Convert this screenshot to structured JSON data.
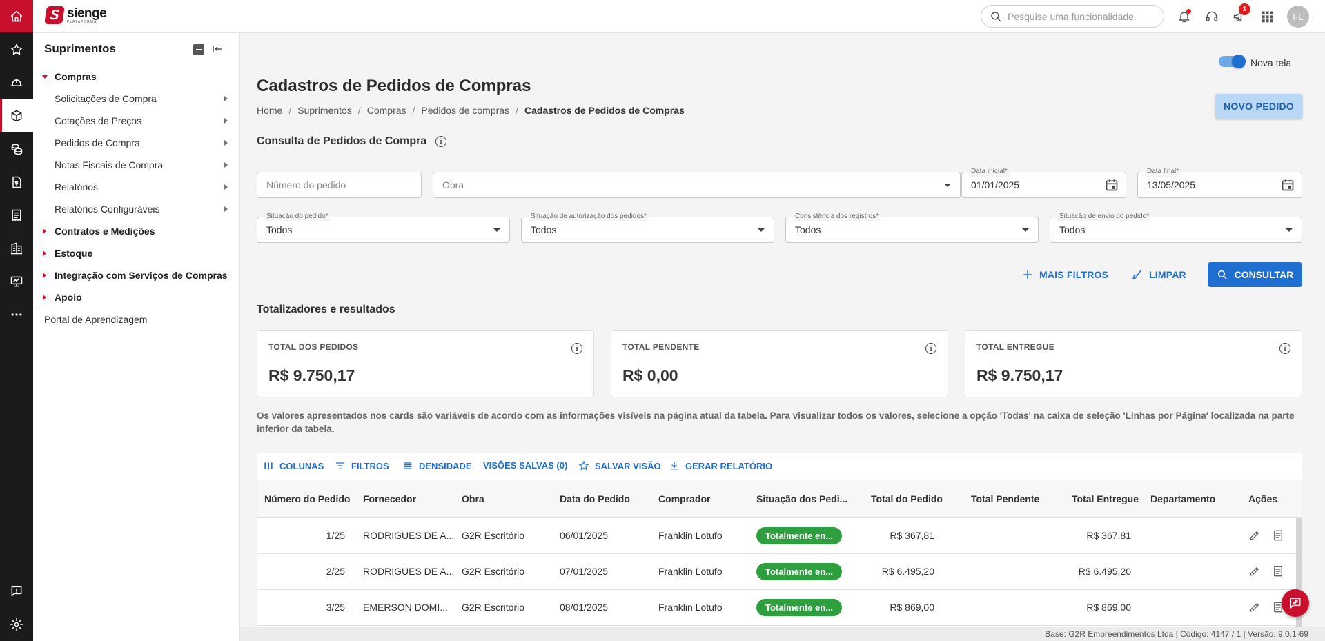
{
  "app": {
    "logo_name": "sienge",
    "logo_sub": "PLATAFORMA",
    "avatar_initials": "FL",
    "notification_badge": "1",
    "search_placeholder": "Pesquise uma funcionalidade."
  },
  "rail": {
    "icons": [
      "home-icon",
      "star-icon",
      "helmet-icon",
      "box-icon",
      "coins-icon",
      "document-dollar-icon",
      "receipt-icon",
      "building-icon",
      "monitor-icon",
      "more-icon",
      "chat-icon",
      "settings-icon"
    ]
  },
  "sidebar": {
    "title": "Suprimentos",
    "items": [
      {
        "label": "Compras",
        "type": "category-open"
      },
      {
        "label": "Solicitações de Compra",
        "type": "sub"
      },
      {
        "label": "Cotações de Preços",
        "type": "sub"
      },
      {
        "label": "Pedidos de Compra",
        "type": "sub"
      },
      {
        "label": "Notas Fiscais de Compra",
        "type": "sub"
      },
      {
        "label": "Relatórios",
        "type": "sub"
      },
      {
        "label": "Relatórios Configuráveis",
        "type": "sub"
      },
      {
        "label": "Contratos e Medições",
        "type": "category"
      },
      {
        "label": "Estoque",
        "type": "category"
      },
      {
        "label": "Integração com Serviços de Compras",
        "type": "category"
      },
      {
        "label": "Apoio",
        "type": "category"
      },
      {
        "label": "Portal de Aprendizagem",
        "type": "plain"
      }
    ]
  },
  "header": {
    "toggle_label": "Nova tela",
    "title": "Cadastros de Pedidos de Compras",
    "new_button": "NOVO PEDIDO",
    "breadcrumb": [
      "Home",
      "Suprimentos",
      "Compras",
      "Pedidos de compras",
      "Cadastros de Pedidos de Compras"
    ]
  },
  "filters": {
    "section_title": "Consulta de Pedidos de Compra",
    "numero_placeholder": "Número do pedido",
    "obra_placeholder": "Obra",
    "data_inicial_label": "Data inicial*",
    "data_inicial_value": "01/01/2025",
    "data_final_label": "Data final*",
    "data_final_value": "13/05/2025",
    "selects": [
      {
        "label": "Situação do pedido*",
        "value": "Todos"
      },
      {
        "label": "Situação de autorização dos pedidos*",
        "value": "Todos"
      },
      {
        "label": "Consistência dos registros*",
        "value": "Todos"
      },
      {
        "label": "Situação de envio do pedido*",
        "value": "Todos"
      }
    ],
    "mais_filtros": "MAIS FILTROS",
    "limpar": "LIMPAR",
    "consultar": "CONSULTAR"
  },
  "totals": {
    "section_title": "Totalizadores e resultados",
    "cards": [
      {
        "label": "TOTAL DOS PEDIDOS",
        "value": "R$ 9.750,17"
      },
      {
        "label": "TOTAL PENDENTE",
        "value": "R$ 0,00"
      },
      {
        "label": "TOTAL ENTREGUE",
        "value": "R$ 9.750,17"
      }
    ],
    "note": "Os valores apresentados nos cards são variáveis de acordo com as informações visíveis na página atual da tabela. Para visualizar todos os valores, selecione a opção 'Todas' na caixa de seleção 'Linhas por Página' localizada na parte inferior da tabela."
  },
  "grid": {
    "toolbar": {
      "colunas": "COLUNAS",
      "filtros": "FILTROS",
      "densidade": "DENSIDADE",
      "visoes": "VISÕES SALVAS (0)",
      "salvar": "SALVAR VISÃO",
      "gerar": "GERAR RELATÓRIO"
    },
    "columns": [
      "Número do Pedido",
      "Fornecedor",
      "Obra",
      "Data do Pedido",
      "Comprador",
      "Situação dos Pedi...",
      "Total do Pedido",
      "Total Pendente",
      "Total Entregue",
      "Departamento",
      "Ações"
    ],
    "rows": [
      {
        "numero": "1/25",
        "fornecedor": "RODRIGUES DE A...",
        "obra": "G2R Escritório",
        "data": "06/01/2025",
        "comprador": "Franklin Lotufo",
        "situacao": "Totalmente en...",
        "total": "R$ 367,81",
        "pendente": "",
        "entregue": "R$ 367,81",
        "departamento": ""
      },
      {
        "numero": "2/25",
        "fornecedor": "RODRIGUES DE A...",
        "obra": "G2R Escritório",
        "data": "07/01/2025",
        "comprador": "Franklin Lotufo",
        "situacao": "Totalmente en...",
        "total": "R$ 6.495,20",
        "pendente": "",
        "entregue": "R$ 6.495,20",
        "departamento": ""
      },
      {
        "numero": "3/25",
        "fornecedor": "EMERSON DOMI...",
        "obra": "G2R Escritório",
        "data": "08/01/2025",
        "comprador": "Franklin Lotufo",
        "situacao": "Totalmente en...",
        "total": "R$ 869,00",
        "pendente": "",
        "entregue": "R$ 869,00",
        "departamento": ""
      }
    ]
  },
  "footer": {
    "text": "Base: G2R Empreendimentos Ltda | Código: 4147 / 1 | Versão: 9.0.1-69"
  },
  "colors": {
    "brand": "#c8102e",
    "primary": "#1f6fd1",
    "success": "#2e9f3e"
  }
}
